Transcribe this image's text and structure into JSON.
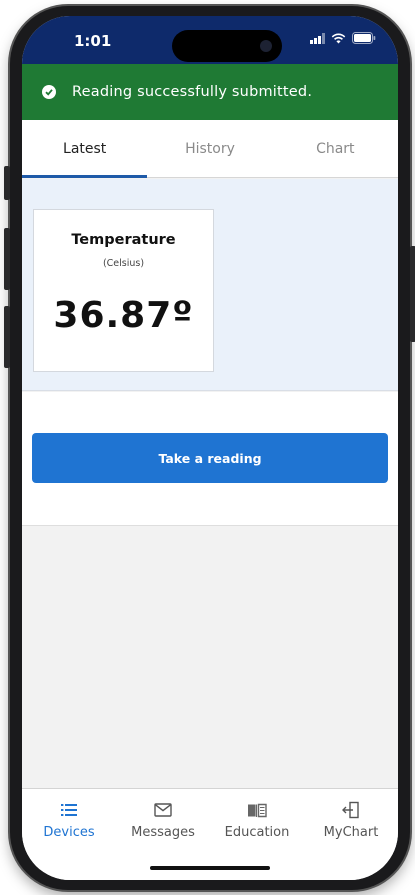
{
  "status_bar": {
    "time": "1:01"
  },
  "banner": {
    "message": "Reading successfully submitted.",
    "icon": "check-circle-icon",
    "color": "#1f7a34"
  },
  "tabs": [
    {
      "label": "Latest",
      "active": true
    },
    {
      "label": "History",
      "active": false
    },
    {
      "label": "Chart",
      "active": false
    }
  ],
  "reading_card": {
    "title": "Temperature",
    "unit": "(Celsius)",
    "value": "36.87º"
  },
  "actions": {
    "take_reading_label": "Take a reading"
  },
  "bottom_nav": [
    {
      "label": "Devices",
      "icon": "list-icon",
      "active": true
    },
    {
      "label": "Messages",
      "icon": "envelope-icon",
      "active": false
    },
    {
      "label": "Education",
      "icon": "book-icon",
      "active": false
    },
    {
      "label": "MyChart",
      "icon": "exit-door-icon",
      "active": false
    }
  ],
  "colors": {
    "status_bar": "#0e2a6b",
    "accent": "#1f74d2",
    "tab_underline": "#1e5aa8",
    "success": "#1f7a34"
  }
}
